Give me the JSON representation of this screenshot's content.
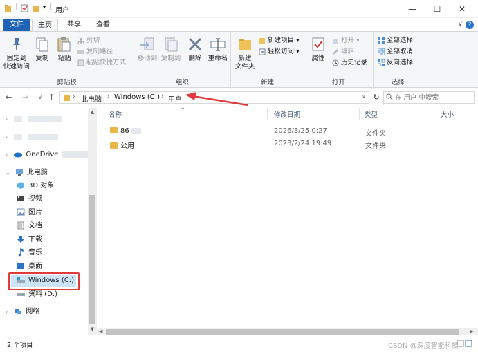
{
  "window": {
    "title": "用户",
    "minimize_glyph": "—",
    "maximize_glyph": "☐",
    "close_glyph": "✕"
  },
  "ribbon_tabs": {
    "file": "文件",
    "home": "主页",
    "share": "共享",
    "view": "查看",
    "help": "?",
    "collapse": "∨"
  },
  "ribbon": {
    "clipboard": {
      "label": "剪贴板",
      "pin": "固定到\n快速访问",
      "pin_l1": "固定到",
      "pin_l2": "快速访问",
      "copy": "复制",
      "paste": "粘贴",
      "cut": "剪切",
      "copy_path": "复制路径",
      "paste_shortcut": "粘贴快捷方式"
    },
    "organize": {
      "label": "组织",
      "move_to": "移动到",
      "copy_to": "复制到",
      "delete": "删除",
      "rename": "重命名"
    },
    "new": {
      "label": "新建",
      "new_folder_l1": "新建",
      "new_folder_l2": "文件夹",
      "new_item": "新建项目 ▾",
      "easy_access": "轻松访问 ▾"
    },
    "open": {
      "label": "打开",
      "properties": "属性",
      "open": "打开 ▾",
      "edit": "编辑",
      "history": "历史记录"
    },
    "select": {
      "label": "选择",
      "select_all": "全部选择",
      "select_none": "全部取消",
      "invert": "反向选择"
    }
  },
  "address": {
    "back": "←",
    "forward": "→",
    "recent": "∨",
    "up": "↑",
    "crumbs": [
      "此电脑",
      "Windows (C:)",
      "用户"
    ],
    "sep": "›",
    "dropdown": "∨",
    "refresh": "↻",
    "search_placeholder": "在 用户 中搜索"
  },
  "nav": {
    "onedrive": "OneDrive",
    "this_pc": "此电脑",
    "items": [
      "3D 对象",
      "视频",
      "图片",
      "文档",
      "下载",
      "音乐",
      "桌面",
      "Windows (C:)",
      "资料 (D:)"
    ],
    "network": "网络"
  },
  "columns": {
    "name": "名称",
    "date": "修改日期",
    "type": "类型",
    "size": "大小",
    "sort_glyph": "^"
  },
  "files": [
    {
      "name": "86",
      "date": "2026/3/25 0:27",
      "type": "文件夹"
    },
    {
      "name": "公用",
      "date": "2023/2/24 19:49",
      "type": "文件夹"
    }
  ],
  "status": {
    "count": "2 个项目",
    "watermark": "CSDN @深度智能科技"
  },
  "colors": {
    "file_tab": "#1f63b6",
    "folder": "#e8b64a",
    "selection": "#cce4f7",
    "annotation_red": "#e03a3a"
  }
}
